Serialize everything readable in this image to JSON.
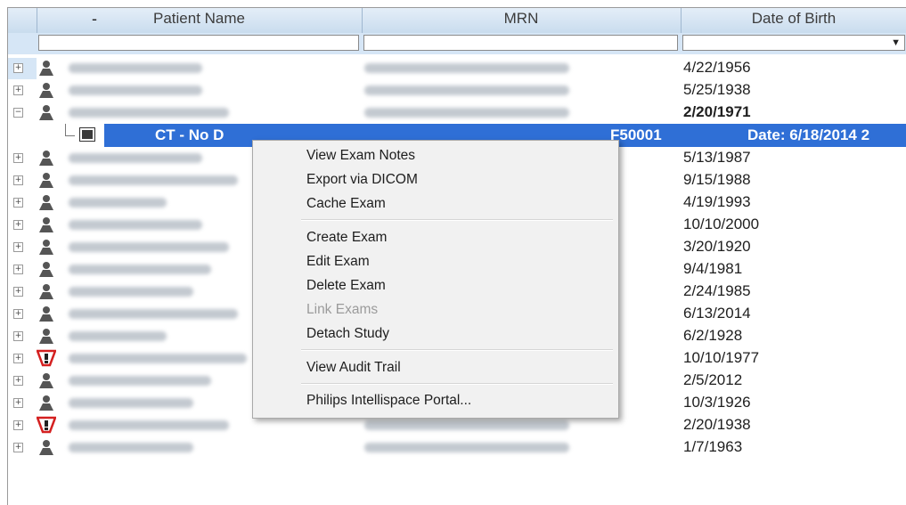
{
  "columns": [
    {
      "label": "Patient Name",
      "sort": "-"
    },
    {
      "label": "MRN"
    },
    {
      "label": "Date of Birth"
    }
  ],
  "patients": [
    {
      "dob": "4/22/1956",
      "icon": "person-icon"
    },
    {
      "dob": "5/25/1938",
      "icon": "person-icon"
    },
    {
      "dob": "2/20/1971",
      "icon": "person-icon",
      "expanded": true
    },
    {
      "dob": "5/13/1987",
      "icon": "person-icon"
    },
    {
      "dob": "9/15/1988",
      "icon": "person-icon"
    },
    {
      "dob": "4/19/1993",
      "icon": "person-icon"
    },
    {
      "dob": "10/10/2000",
      "icon": "person-icon"
    },
    {
      "dob": "3/20/1920",
      "icon": "person-icon"
    },
    {
      "dob": "9/4/1981",
      "icon": "person-icon"
    },
    {
      "dob": "2/24/1985",
      "icon": "person-icon"
    },
    {
      "dob": "6/13/2014",
      "icon": "person-icon"
    },
    {
      "dob": "6/2/1928",
      "icon": "person-icon"
    },
    {
      "dob": "10/10/1977",
      "icon": "alert-icon"
    },
    {
      "dob": "2/5/2012",
      "icon": "person-icon"
    },
    {
      "dob": "10/3/1926",
      "icon": "person-icon"
    },
    {
      "dob": "2/20/1938",
      "icon": "alert-icon"
    },
    {
      "dob": "1/7/1963",
      "icon": "person-icon"
    }
  ],
  "exam": {
    "description": "CT - No D",
    "id_fragment": "F50001",
    "date": "Date: 6/18/2014 2"
  },
  "context_menu": {
    "items": [
      {
        "label": "View Exam Notes",
        "enabled": true
      },
      {
        "label": "Export via DICOM",
        "enabled": true
      },
      {
        "label": "Cache Exam",
        "enabled": true
      },
      {
        "label": "Create Exam",
        "enabled": true
      },
      {
        "label": "Edit Exam",
        "enabled": true
      },
      {
        "label": "Delete Exam",
        "enabled": true
      },
      {
        "label": "Link Exams",
        "enabled": false
      },
      {
        "label": "Detach Study",
        "enabled": true
      },
      {
        "label": "View Audit Trail",
        "enabled": true
      },
      {
        "label": "Philips Intellispace Portal...",
        "enabled": true
      }
    ]
  },
  "colors": {
    "selection": "#2f6fd6",
    "header": "#c9dcee",
    "alert": "#d42020"
  }
}
